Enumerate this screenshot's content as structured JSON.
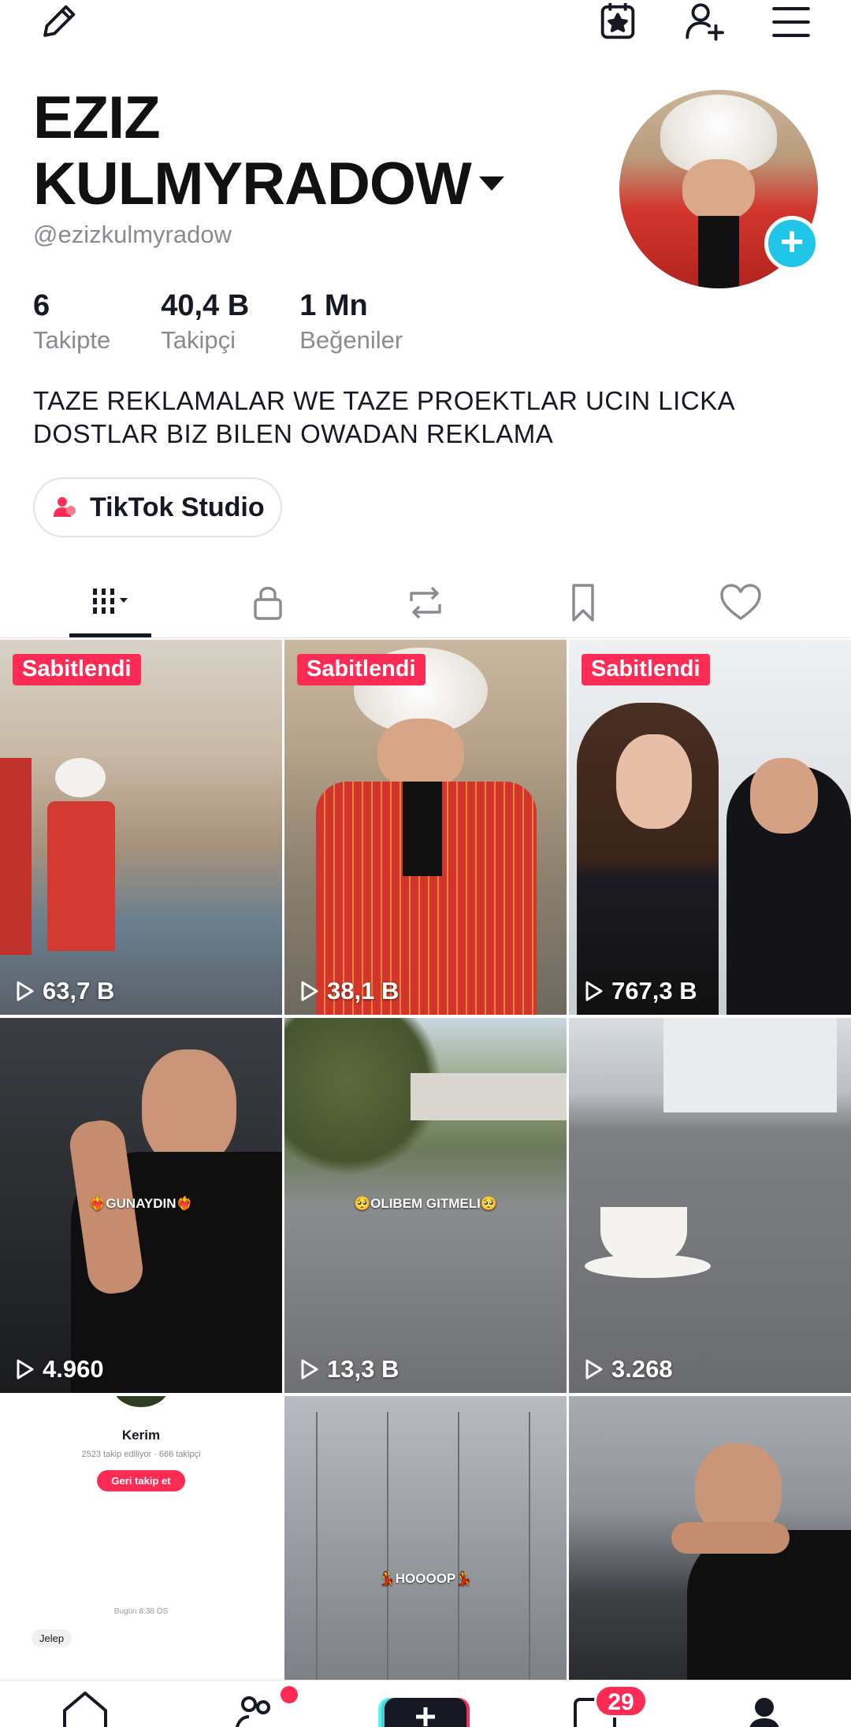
{
  "header": {
    "icons": [
      "pencil-icon",
      "calendar-star-icon",
      "add-friend-icon",
      "menu-icon"
    ]
  },
  "profile": {
    "name_line1": "EZIZ",
    "name_line2": "KULMYRADOW",
    "handle": "@ezizkulmyradow",
    "stats": [
      {
        "value": "6",
        "label": "Takipte"
      },
      {
        "value": "40,4 B",
        "label": "Takipçi"
      },
      {
        "value": "1 Mn",
        "label": "Beğeniler"
      }
    ],
    "bio_line1": "TAZE REKLAMALAR WE TAZE PROEKTLAR UCIN LICKA",
    "bio_line2": "DOSTLAR BIZ BILEN OWADAN REKLAMA",
    "studio_button": "TikTok Studio"
  },
  "tabs": [
    "videos-tab",
    "private-tab",
    "reposts-tab",
    "favorites-tab",
    "liked-tab"
  ],
  "grid": {
    "pinned_label": "Sabitlendi",
    "videos": [
      {
        "views": "63,7 B",
        "pinned": true
      },
      {
        "views": "38,1 B",
        "pinned": true
      },
      {
        "views": "767,3 B",
        "pinned": true
      },
      {
        "views": "4.960",
        "caption": "❤️‍🔥GUNAYDIN❤️‍🔥"
      },
      {
        "views": "13,3 B",
        "caption": "🥺OLIBEM GITMELI🥺"
      },
      {
        "views": "3.268"
      },
      {
        "mini_name": "Kerim",
        "mini_meta": "2523 takip ediliyor · 666 takipçi",
        "mini_button": "Geri takip et",
        "mini_time": "Bugün 8:38 ÖS",
        "mini_chip": "Jelep"
      },
      {
        "caption": "💃HOOOOP💃"
      },
      {}
    ]
  },
  "bottom_nav": {
    "inbox_badge": "29"
  },
  "colors": {
    "accent": "#fe2c55",
    "avatar_plus": "#20c5e8",
    "muted_text": "#8a8b91"
  }
}
